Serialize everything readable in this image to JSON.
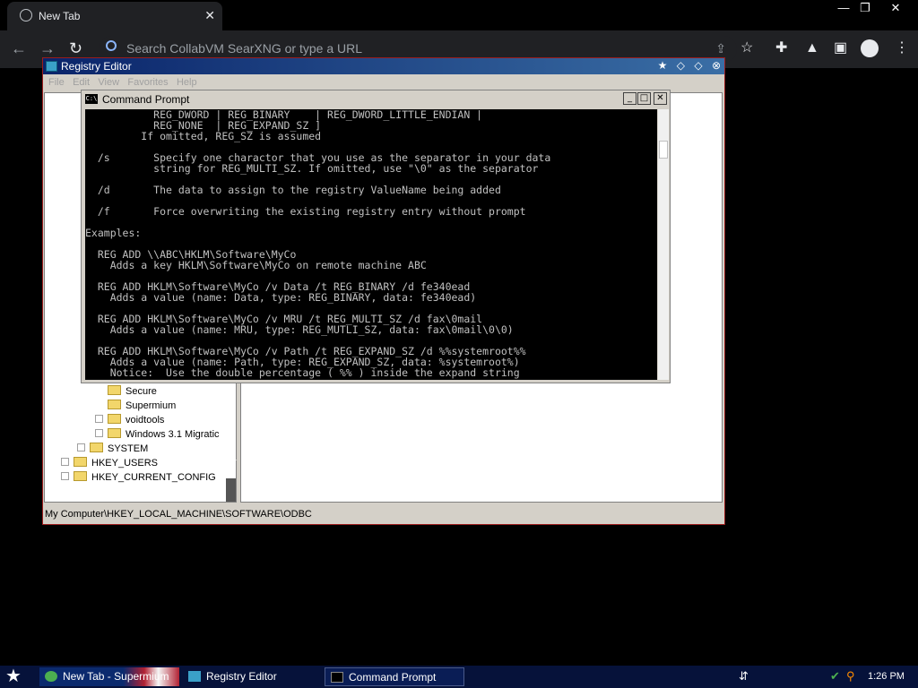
{
  "browser": {
    "tab_title": "New Tab",
    "tab_close": "✕",
    "window_controls": [
      "—",
      "❐",
      "✕"
    ],
    "omnibox_placeholder": "Search CollabVM SearXNG or type a URL",
    "icons": [
      "back-icon",
      "forward-icon",
      "reload-icon",
      "search-icon",
      "share-icon",
      "bookmark-star-icon",
      "extensions-icon",
      "lab-icon",
      "side-panel-icon",
      "profile-icon",
      "menu-icon"
    ]
  },
  "regedit": {
    "title": "Registry Editor",
    "menu": [
      "File",
      "Edit",
      "View",
      "Favorites",
      "Help"
    ],
    "tree": [
      {
        "label": "Secure"
      },
      {
        "label": "Supermium"
      },
      {
        "label": "voidtools"
      },
      {
        "label": "Windows 3.1 Migratic"
      },
      {
        "label": "SYSTEM"
      },
      {
        "label": "HKEY_USERS"
      },
      {
        "label": "HKEY_CURRENT_CONFIG"
      }
    ],
    "status": "My Computer\\HKEY_LOCAL_MACHINE\\SOFTWARE\\ODBC"
  },
  "cmd": {
    "title": "Command Prompt",
    "icon_text": "C:\\",
    "buttons": [
      "_",
      "□",
      "✕"
    ],
    "lines": [
      "           REG_DWORD | REG_BINARY    | REG_DWORD_LITTLE_ENDIAN |",
      "           REG_NONE  | REG_EXPAND_SZ ]",
      "         If omitted, REG_SZ is assumed",
      "",
      "  /s       Specify one charactor that you use as the separator in your data",
      "           string for REG_MULTI_SZ. If omitted, use \"\\0\" as the separator",
      "",
      "  /d       The data to assign to the registry ValueName being added",
      "",
      "  /f       Force overwriting the existing registry entry without prompt",
      "",
      "Examples:",
      "",
      "  REG ADD \\\\ABC\\HKLM\\Software\\MyCo",
      "    Adds a key HKLM\\Software\\MyCo on remote machine ABC",
      "",
      "  REG ADD HKLM\\Software\\MyCo /v Data /t REG_BINARY /d fe340ead",
      "    Adds a value (name: Data, type: REG_BINARY, data: fe340ead)",
      "",
      "  REG ADD HKLM\\Software\\MyCo /v MRU /t REG_MULTI_SZ /d fax\\0mail",
      "    Adds a value (name: MRU, type: REG_MUTLI_SZ, data: fax\\0mail\\0\\0)",
      "",
      "  REG ADD HKLM\\Software\\MyCo /v Path /t REG_EXPAND_SZ /d %%systemroot%%",
      "    Adds a value (name: Path, type: REG_EXPAND_SZ, data: %systemroot%)",
      "    Notice:  Use the double percentage ( %% ) inside the expand string"
    ]
  },
  "taskbar": {
    "start_icon": "start-icon",
    "tasks": [
      "New Tab - Supermium",
      "Registry Editor",
      "Command Prompt"
    ],
    "clock": "1:26 PM"
  }
}
